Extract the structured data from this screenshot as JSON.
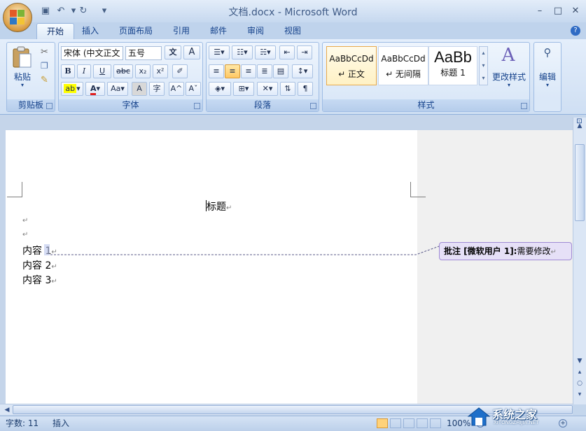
{
  "window": {
    "title": "文档.docx - Microsoft Word"
  },
  "quick_access": {
    "save_icon": "save-icon",
    "undo_icon": "undo-icon",
    "redo_icon": "redo-icon",
    "customize_icon": "customize-icon"
  },
  "window_controls": {
    "minimize": "–",
    "maximize": "□",
    "close": "✕"
  },
  "tabs": [
    {
      "label": "开始",
      "active": true
    },
    {
      "label": "插入"
    },
    {
      "label": "页面布局"
    },
    {
      "label": "引用"
    },
    {
      "label": "邮件"
    },
    {
      "label": "审阅"
    },
    {
      "label": "视图"
    }
  ],
  "help_label": "?",
  "groups": {
    "clipboard": {
      "label": "剪贴板",
      "paste_label": "粘贴"
    },
    "font": {
      "label": "字体",
      "font_name": "宋体 (中文正文",
      "font_size": "五号",
      "bold": "B",
      "italic": "I",
      "underline": "U",
      "strike": "abc",
      "subscript": "x₂",
      "superscript": "x²",
      "font_color": "A",
      "change_case": "Aa",
      "grow": "A",
      "shrink": "A",
      "char_border": "A",
      "phonetic": "wén",
      "enclose": "字"
    },
    "paragraph": {
      "label": "段落"
    },
    "styles": {
      "label": "样式",
      "cards": [
        {
          "sample": "AaBbCcDd",
          "name": "↵ 正文",
          "selected": true
        },
        {
          "sample": "AaBbCcDd",
          "name": "↵ 无间隔"
        },
        {
          "sample": "AaBb",
          "name": "标题 1"
        }
      ],
      "change_styles_label": "更改样式"
    },
    "editing": {
      "label": "编辑"
    }
  },
  "document": {
    "heading": "标题",
    "paragraph_mark": "↵",
    "lines": [
      "内容 1",
      "内容 2",
      "内容 3"
    ]
  },
  "comment": {
    "prefix": "批注 [微软用户 1]:",
    "text": "需要修改"
  },
  "status": {
    "word_count": "字数: 11",
    "mode": "插入",
    "zoom": "100%"
  },
  "watermark": {
    "brand": "系统之家",
    "url": "XITONGZHIJIA.NET"
  },
  "colors": {
    "accent": "#15428b",
    "comment_fill": "#e6e0f7",
    "highlight": "#ffff00",
    "font_red": "#e02020"
  }
}
